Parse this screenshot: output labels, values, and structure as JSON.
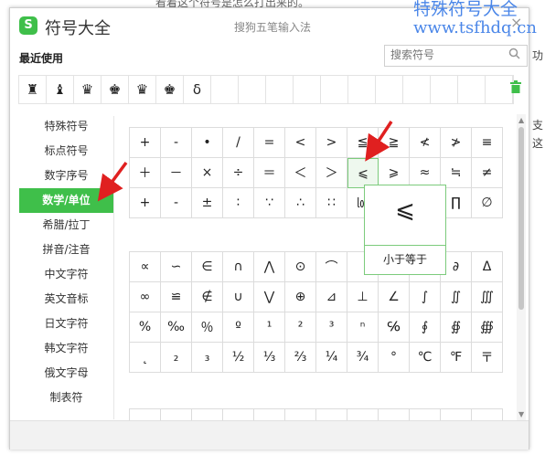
{
  "background": {
    "partial_text": "看着这个符号是怎么打出来的。",
    "right_strip": [
      "功",
      "支",
      "这"
    ]
  },
  "window": {
    "title": "符号大全",
    "subtitle": "搜狗五笔输入法",
    "close": "×",
    "logo_letter": "S"
  },
  "watermark": {
    "line1": "特殊符号大全",
    "line2": "www.tsfhdq.cn"
  },
  "recent": {
    "label": "最近使用",
    "search_placeholder": "搜索符号",
    "symbols": [
      "♜",
      "♝",
      "♛",
      "♚",
      "♛",
      "♚",
      "δ",
      "",
      "",
      "",
      "",
      "",
      "",
      "",
      "",
      "",
      "",
      ""
    ]
  },
  "sidebar": {
    "items": [
      "特殊符号",
      "标点符号",
      "数字序号",
      "数学/单位",
      "希腊/拉丁",
      "拼音/注音",
      "中文字符",
      "英文音标",
      "日文字符",
      "韩文字符",
      "俄文字母",
      "制表符"
    ],
    "active": "数学/单位"
  },
  "grid_a": [
    [
      "+",
      "-",
      "•",
      "/",
      "=",
      "<",
      ">",
      "≦",
      "≧",
      "≮",
      "≯",
      "≡"
    ],
    [
      "＋",
      "－",
      "×",
      "÷",
      "＝",
      "＜",
      "＞",
      "⩽",
      "⩾",
      "≈",
      "≒",
      "≠"
    ],
    [
      "+",
      "-",
      "±",
      "∶",
      "∵",
      "∴",
      "∷",
      "㏒",
      "",
      "",
      "∏",
      "∅"
    ]
  ],
  "grid_b": [
    [
      "∝",
      "∽",
      "∈",
      "∩",
      "⋀",
      "⊙",
      "⌒",
      "",
      "",
      "",
      "∂",
      "Δ"
    ],
    [
      "∞",
      "≌",
      "∉",
      "∪",
      "⋁",
      "⊕",
      "⊿",
      "⊥",
      "∠",
      "∫",
      "∬",
      "∭"
    ],
    [
      "%",
      "‰",
      "％",
      "º",
      "¹",
      "²",
      "³",
      "ⁿ",
      "℅",
      "∮",
      "∯",
      "∰"
    ],
    [
      "˛",
      "₂",
      "₃",
      "½",
      "⅓",
      "⅔",
      "¼",
      "¾",
      "°",
      "℃",
      "℉",
      "〒"
    ]
  ],
  "grid_c": [
    [
      "",
      "",
      "",
      "",
      "",
      "",
      "",
      "",
      "",
      "",
      "",
      ""
    ]
  ],
  "tooltip": {
    "symbol": "⩽",
    "name": "小于等于"
  },
  "icons": {
    "search": "search-icon",
    "trash": "trash-icon",
    "close": "close-icon"
  },
  "colors": {
    "accent": "#3fbf4a",
    "watermark": "#4a86e8",
    "arrow": "#e02020"
  }
}
